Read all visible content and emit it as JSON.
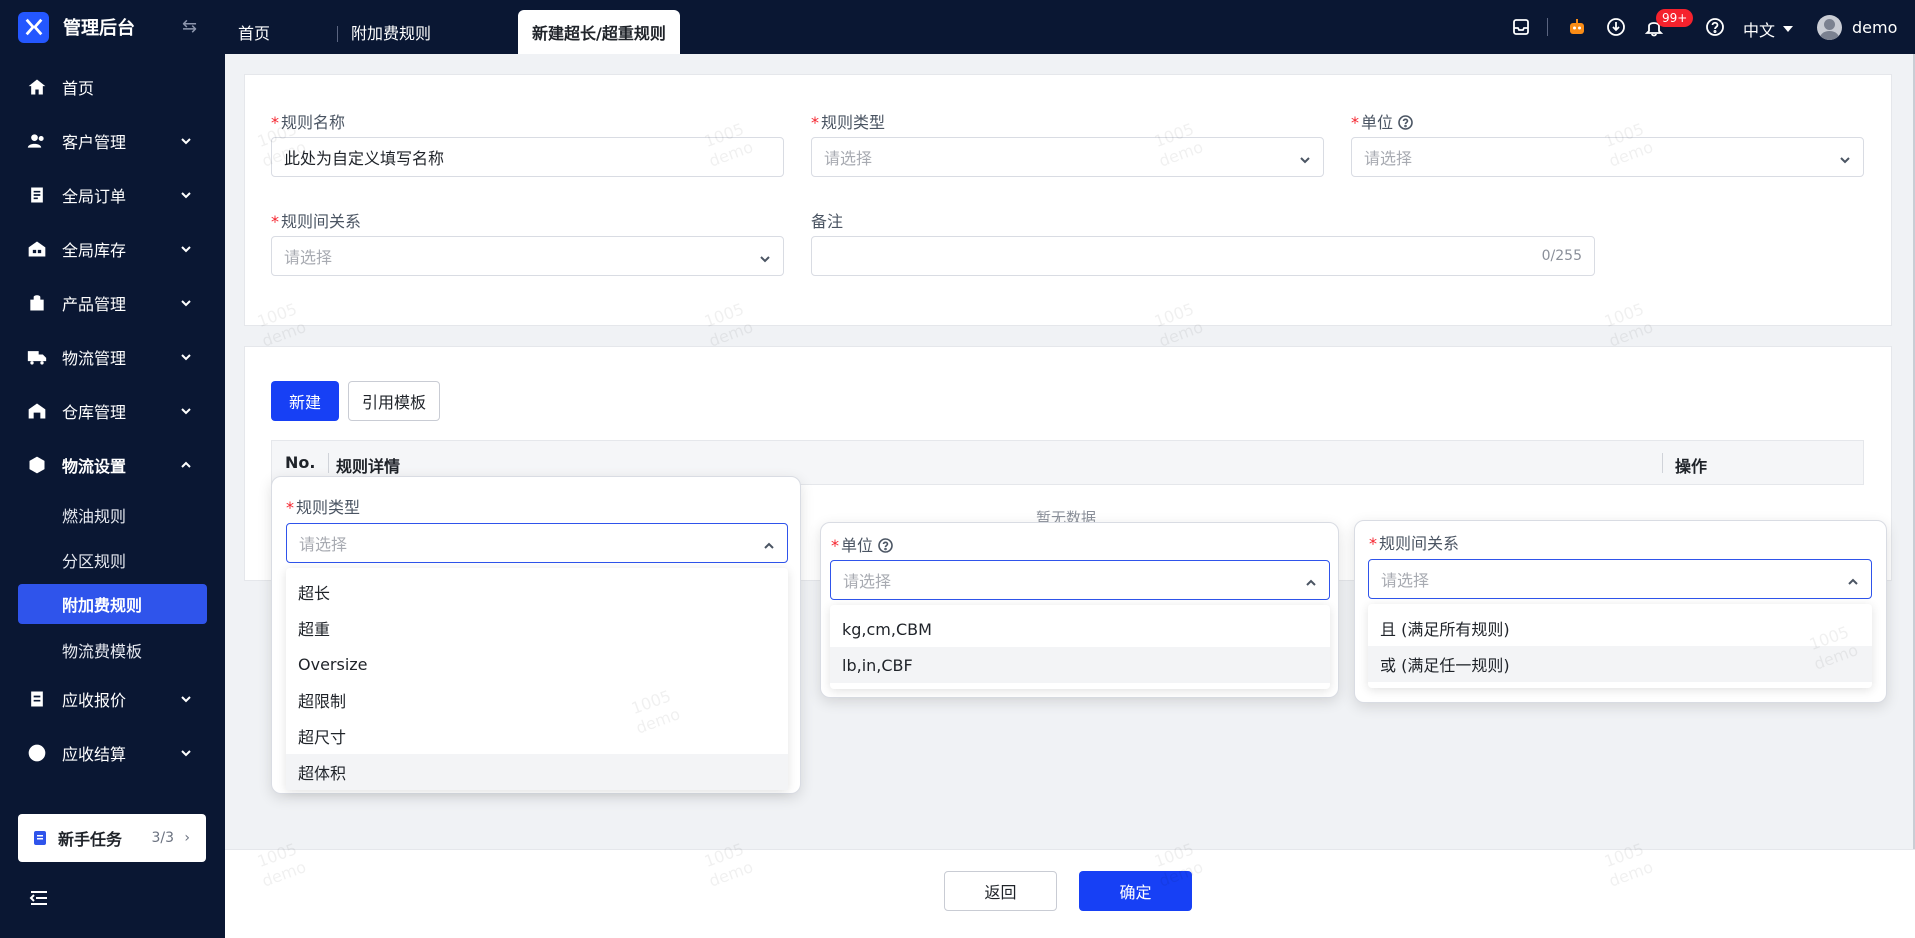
{
  "brand": {
    "title": "管理后台"
  },
  "sidebar": {
    "items": [
      {
        "label": "首页",
        "icon": "home-icon"
      },
      {
        "label": "客户管理",
        "icon": "customers-icon"
      },
      {
        "label": "全局订单",
        "icon": "orders-icon"
      },
      {
        "label": "全局库存",
        "icon": "inventory-icon"
      },
      {
        "label": "产品管理",
        "icon": "product-icon"
      },
      {
        "label": "物流管理",
        "icon": "truck-icon"
      },
      {
        "label": "仓库管理",
        "icon": "warehouse-icon"
      },
      {
        "label": "物流设置",
        "icon": "logistics-settings-icon"
      }
    ],
    "sub_items": [
      "燃油规则",
      "分区规则",
      "附加费规则",
      "物流费模板"
    ],
    "items_after": [
      {
        "label": "应收报价",
        "icon": "quote-icon"
      },
      {
        "label": "应收结算",
        "icon": "settlement-icon"
      }
    ],
    "task": {
      "label": "新手任务",
      "count": "3/3"
    }
  },
  "topbar": {
    "tabs": [
      "首页",
      "附加费规则",
      "新建超长/超重规则"
    ],
    "badge": "99+",
    "language": "中文",
    "user": "demo"
  },
  "form": {
    "rule_name": {
      "label": "规则名称",
      "value": "此处为自定义填写名称"
    },
    "rule_type": {
      "label": "规则类型",
      "placeholder": "请选择"
    },
    "unit": {
      "label": "单位",
      "placeholder": "请选择"
    },
    "rule_relation": {
      "label": "规则间关系",
      "placeholder": "请选择"
    },
    "remark": {
      "label": "备注",
      "counter": "0/255"
    }
  },
  "actions": {
    "new": "新建",
    "template": "引用模板"
  },
  "table": {
    "headers": [
      "No.",
      "规则详情",
      "操作"
    ],
    "empty": "暂无数据"
  },
  "popover_type": {
    "label": "规则类型",
    "placeholder": "请选择",
    "options": [
      "超长",
      "超重",
      "Oversize",
      "超限制",
      "超尺寸",
      "超体积"
    ]
  },
  "popover_unit": {
    "label": "单位",
    "placeholder": "请选择",
    "options": [
      "kg,cm,CBM",
      "lb,in,CBF"
    ]
  },
  "popover_relation": {
    "label": "规则间关系",
    "placeholder": "请选择",
    "options": [
      "且 (满足所有规则)",
      "或 (满足任一规则)"
    ]
  },
  "footer": {
    "back": "返回",
    "confirm": "确定"
  },
  "watermark": {
    "line1": "1005",
    "line2": "demo"
  },
  "colors": {
    "sidebar_bg": "#0a1733",
    "primary": "#1740f5",
    "active_menu": "#2f54eb"
  }
}
